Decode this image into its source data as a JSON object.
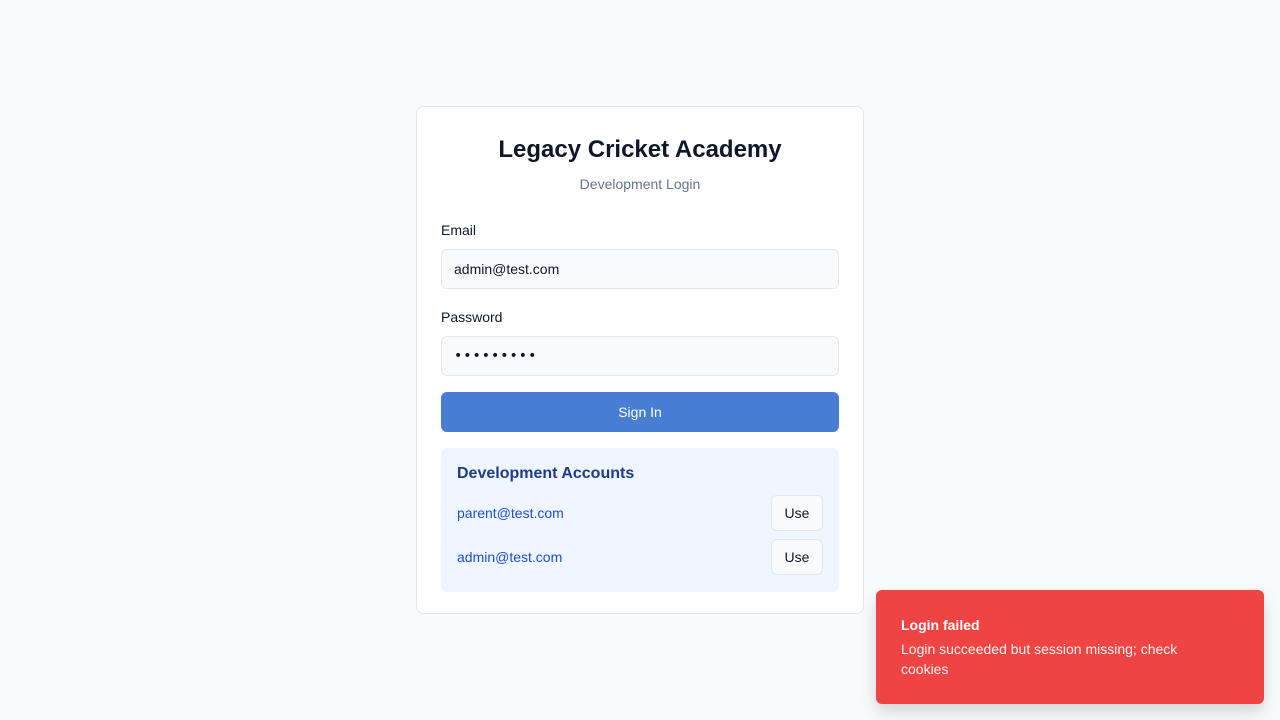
{
  "login": {
    "title": "Legacy Cricket Academy",
    "subtitle": "Development Login",
    "email_label": "Email",
    "email_value": "admin@test.com",
    "password_label": "Password",
    "password_value": "•••••••••",
    "signin_label": "Sign In"
  },
  "dev_accounts": {
    "title": "Development Accounts",
    "accounts": [
      {
        "email": "parent@test.com",
        "button_label": "Use"
      },
      {
        "email": "admin@test.com",
        "button_label": "Use"
      }
    ]
  },
  "toast": {
    "title": "Login failed",
    "message": "Login succeeded but session missing; check cookies"
  },
  "colors": {
    "background": "#f8fafc",
    "primary_button": "#477ed4",
    "dev_box": "#eff6ff",
    "dev_title": "#1e3a8a",
    "link_text": "#1d4ed8",
    "toast_bg": "#ef4444"
  }
}
